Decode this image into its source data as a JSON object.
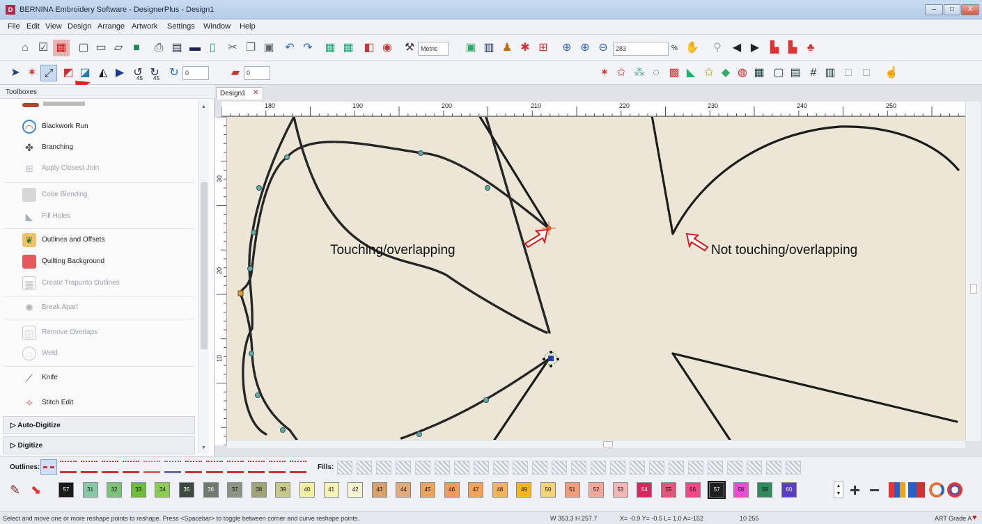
{
  "window": {
    "title": "BERNINA Embroidery Software - DesignerPlus - Design1",
    "logo": "D",
    "min": "–",
    "max": "□",
    "close": "X"
  },
  "menu": [
    "File",
    "Edit",
    "View",
    "Design",
    "Arrange",
    "Artwork",
    "Settings",
    "Window",
    "Help"
  ],
  "toolbar": {
    "units_select": "Metric",
    "zoom_value": "283",
    "zoom_unit": "%",
    "rotate_value": "0",
    "skew_value": "0",
    "rotate_45_left": "45",
    "rotate_45_right": "45"
  },
  "toolbox": {
    "header": "Toolboxes",
    "items": [
      {
        "label": "Blackwork Run",
        "enabled": true,
        "icon": "blackwork-run-icon",
        "color": "#c94a2b"
      },
      {
        "label": "Branching",
        "enabled": true,
        "icon": "branching-icon",
        "color": "#6b7a86"
      },
      {
        "label": "Apply Closest Join",
        "enabled": false,
        "icon": "apply-closest-join-icon",
        "color": "#7a8a9a"
      },
      {
        "label": "Color Blending",
        "enabled": false,
        "icon": "color-blending-icon",
        "color": "#9aa0a6"
      },
      {
        "label": "Fill Holes",
        "enabled": false,
        "icon": "fill-holes-icon",
        "color": "#7a8a9a"
      },
      {
        "label": "Outlines and Offsets",
        "enabled": true,
        "icon": "outlines-offsets-icon",
        "color": "#4f8f3a"
      },
      {
        "label": "Quilting Background",
        "enabled": true,
        "icon": "quilting-background-icon",
        "color": "#e05555"
      },
      {
        "label": "Create Trapunto Outlines",
        "enabled": false,
        "icon": "trapunto-outlines-icon",
        "color": "#8894a0"
      },
      {
        "label": "Break Apart",
        "enabled": false,
        "icon": "break-apart-icon",
        "color": "#8894a0"
      },
      {
        "label": "Remove Overlaps",
        "enabled": false,
        "icon": "remove-overlaps-icon",
        "color": "#8894a0"
      },
      {
        "label": "Weld",
        "enabled": false,
        "icon": "weld-icon",
        "color": "#8894a0"
      },
      {
        "label": "Knife",
        "enabled": true,
        "icon": "knife-icon",
        "color": "#5577cc"
      },
      {
        "label": "Stitch Edit",
        "enabled": true,
        "icon": "stitch-edit-icon",
        "color": "#d04040"
      }
    ],
    "groups": [
      "Auto-Digitize",
      "Digitize"
    ]
  },
  "document": {
    "tab": "Design1",
    "ruler_h": [
      "180",
      "190",
      "200",
      "210",
      "220",
      "230",
      "240",
      "250"
    ],
    "ruler_v": [
      "30",
      "20",
      "10"
    ]
  },
  "annotations": {
    "touching": "Touching/overlapping",
    "not_touching": "Not touching/overlapping"
  },
  "bottom": {
    "outlines_label": "Outlines:",
    "fills_label": "Fills:",
    "swatches": [
      {
        "n": "57",
        "c": "#1a1a1a"
      },
      {
        "n": "31",
        "c": "#88c9a8"
      },
      {
        "n": "32",
        "c": "#7cc27a"
      },
      {
        "n": "33",
        "c": "#6bbd3a"
      },
      {
        "n": "34",
        "c": "#8ccb54"
      },
      {
        "n": "35",
        "c": "#3f4a3f"
      },
      {
        "n": "36",
        "c": "#6f7b6d"
      },
      {
        "n": "37",
        "c": "#8c9483"
      },
      {
        "n": "38",
        "c": "#9da374"
      },
      {
        "n": "39",
        "c": "#c7c98a"
      },
      {
        "n": "40",
        "c": "#f2f1a0"
      },
      {
        "n": "41",
        "c": "#f7f4b8"
      },
      {
        "n": "42",
        "c": "#f8f3d2"
      },
      {
        "n": "43",
        "c": "#d7a06d"
      },
      {
        "n": "44",
        "c": "#e3ab7b"
      },
      {
        "n": "45",
        "c": "#e9a45e"
      },
      {
        "n": "46",
        "c": "#f09a5c"
      },
      {
        "n": "47",
        "c": "#f3a25b"
      },
      {
        "n": "48",
        "c": "#f5b35c"
      },
      {
        "n": "49",
        "c": "#f7b51f"
      },
      {
        "n": "50",
        "c": "#f6d27a"
      },
      {
        "n": "51",
        "c": "#f29c7a"
      },
      {
        "n": "52",
        "c": "#f4a79a"
      },
      {
        "n": "53",
        "c": "#f3b7b6"
      },
      {
        "n": "54",
        "c": "#d7285c"
      },
      {
        "n": "55",
        "c": "#e2567a"
      },
      {
        "n": "56",
        "c": "#ef4a85"
      },
      {
        "n": "57",
        "c": "#202020"
      },
      {
        "n": "58",
        "c": "#e84cd2"
      },
      {
        "n": "59",
        "c": "#2f8a5c"
      },
      {
        "n": "60",
        "c": "#5b3ec2"
      }
    ]
  },
  "status": {
    "hint": "Select and move one or more reshape points to reshape. Press <Spacebar> to toggle between corner and curve reshape points.",
    "size": "W 353.3 H 257.7",
    "coords": "X= -0.9 Y= -0.5 L= 1.0 A=-152",
    "stitches": "10 255",
    "grade": "ART Grade A"
  }
}
